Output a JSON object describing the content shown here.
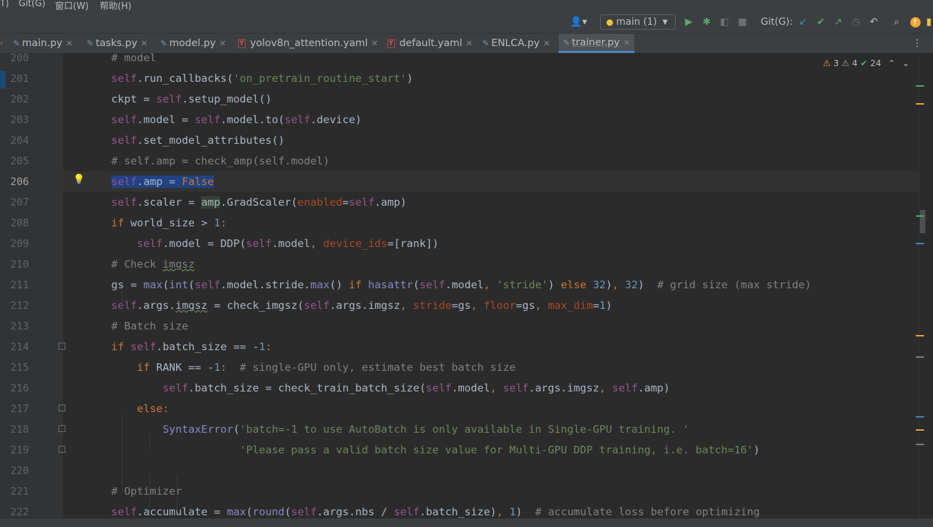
{
  "menu": {
    "items": [
      "T)",
      "Git(G)",
      "窗口(W)",
      "帮助(H)"
    ]
  },
  "toolbar": {
    "branch_label": "main (1)",
    "git_label": "Git(G):"
  },
  "tabs": [
    {
      "label": "main.py",
      "type": "py"
    },
    {
      "label": "tasks.py",
      "type": "py"
    },
    {
      "label": "model.py",
      "type": "py"
    },
    {
      "label": "yolov8n_attention.yaml",
      "type": "yaml"
    },
    {
      "label": "default.yaml",
      "type": "yaml"
    },
    {
      "label": "ENLCA.py",
      "type": "py"
    },
    {
      "label": "trainer.py",
      "type": "py",
      "active": true
    }
  ],
  "inspections": {
    "warnings": "3",
    "weak_warnings": "4",
    "ok": "24"
  },
  "editor": {
    "current_line": 206,
    "lines": [
      {
        "n": "200",
        "text": "        # model"
      },
      {
        "n": "201",
        "text": "        self.run_callbacks('on_pretrain_routine_start')"
      },
      {
        "n": "202",
        "text": "        ckpt = self.setup_model()"
      },
      {
        "n": "203",
        "text": "        self.model = self.model.to(self.device)"
      },
      {
        "n": "204",
        "text": "        self.set_model_attributes()"
      },
      {
        "n": "205",
        "text": "        # self.amp = check_amp(self.model)"
      },
      {
        "n": "206",
        "text": "        self.amp = False"
      },
      {
        "n": "207",
        "text": "        self.scaler = amp.GradScaler(enabled=self.amp)"
      },
      {
        "n": "208",
        "text": "        if world_size > 1:"
      },
      {
        "n": "209",
        "text": "            self.model = DDP(self.model, device_ids=[rank])"
      },
      {
        "n": "210",
        "text": "        # Check imgsz"
      },
      {
        "n": "211",
        "text": "        gs = max(int(self.model.stride.max() if hasattr(self.model, 'stride') else 32), 32)  # grid size (max stride)"
      },
      {
        "n": "212",
        "text": "        self.args.imgsz = check_imgsz(self.args.imgsz, stride=gs, floor=gs, max_dim=1)"
      },
      {
        "n": "213",
        "text": "        # Batch size"
      },
      {
        "n": "214",
        "text": "        if self.batch_size == -1:"
      },
      {
        "n": "215",
        "text": "            if RANK == -1:  # single-GPU only, estimate best batch size"
      },
      {
        "n": "216",
        "text": "                self.batch_size = check_train_batch_size(self.model, self.args.imgsz, self.amp)"
      },
      {
        "n": "217",
        "text": "            else:"
      },
      {
        "n": "218",
        "text": "                SyntaxError('batch=-1 to use AutoBatch is only available in Single-GPU training. '"
      },
      {
        "n": "219",
        "text": "                            'Please pass a valid batch size value for Multi-GPU DDP training, i.e. batch=16')"
      },
      {
        "n": "220",
        "text": ""
      },
      {
        "n": "221",
        "text": "        # Optimizer"
      },
      {
        "n": "222",
        "text": "        self.accumulate = max(round(self.args.nbs / self.batch_size), 1)  # accumulate loss before optimizing"
      }
    ]
  }
}
